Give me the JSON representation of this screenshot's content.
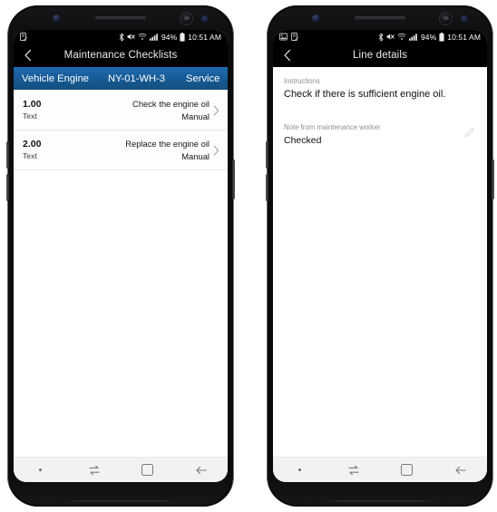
{
  "theme": {
    "accent_blue": "#165891",
    "titlebar_bg": "#000000",
    "screen_bg": "#ffffff",
    "navbar_bg": "#f2f2f2"
  },
  "phones": {
    "left": {
      "status_bar": {
        "notification_icons": [
          "document-lock-icon"
        ],
        "bluetooth": "bluetooth-icon",
        "mute": "volume-mute-icon",
        "wifi": "wifi-icon",
        "signal": "signal-bars-icon",
        "battery_percent": "94%",
        "battery": "battery-icon",
        "clock": "10:51 AM"
      },
      "title_bar": {
        "back": "back-chevron-icon",
        "title": "Maintenance Checklists"
      },
      "context_bar": {
        "col1": "Vehicle Engine",
        "col2": "NY-01-WH-3",
        "col3": "Service"
      },
      "list": {
        "rows": [
          {
            "number": "1.00",
            "type": "Text",
            "title": "Check the engine oil",
            "meta": "Manual",
            "chevron": "chevron-right-icon"
          },
          {
            "number": "2.00",
            "type": "Text",
            "title": "Replace the engine oil",
            "meta": "Manual",
            "chevron": "chevron-right-icon"
          }
        ]
      },
      "nav_bar": {
        "dot": "nav-dot-icon",
        "recents": "recents-swap-icon",
        "home": "home-square-icon",
        "back": "back-arrow-icon"
      }
    },
    "right": {
      "status_bar": {
        "notification_icons": [
          "image-icon",
          "document-lock-icon"
        ],
        "bluetooth": "bluetooth-icon",
        "mute": "volume-mute-icon",
        "wifi": "wifi-icon",
        "signal": "signal-bars-icon",
        "battery_percent": "94%",
        "battery": "battery-icon",
        "clock": "10:51 AM"
      },
      "title_bar": {
        "back": "back-chevron-icon",
        "title": "Line details"
      },
      "detail": {
        "instructions_label": "Instructions",
        "instructions_value": "Check if there is sufficient engine oil.",
        "note_label": "Note from maintenance worker",
        "note_value": "Checked",
        "edit_icon": "pencil-edit-icon"
      },
      "nav_bar": {
        "dot": "nav-dot-icon",
        "recents": "recents-swap-icon",
        "home": "home-square-icon",
        "back": "back-arrow-icon"
      }
    }
  }
}
